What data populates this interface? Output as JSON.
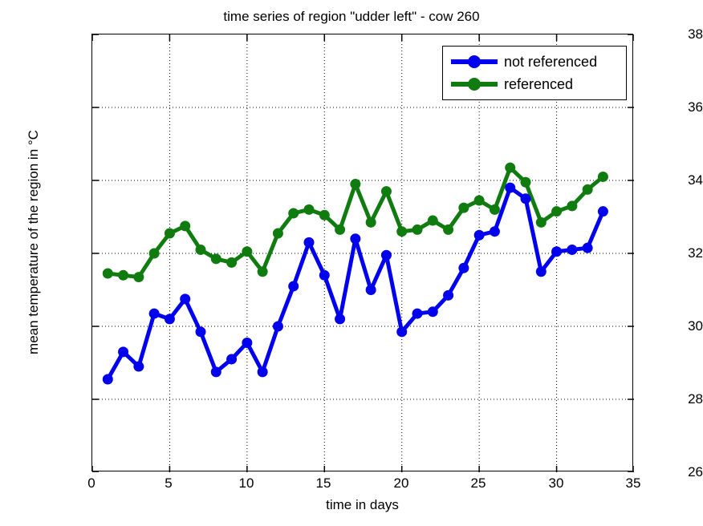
{
  "chart_data": {
    "type": "line",
    "title": "time series of region \"udder left\" - cow 260",
    "xlabel": "time in days",
    "ylabel": "mean temperature of the region in °C",
    "xlim": [
      0,
      35
    ],
    "ylim": [
      26,
      38
    ],
    "xticks": [
      0,
      5,
      10,
      15,
      20,
      25,
      30,
      35
    ],
    "yticks": [
      26,
      28,
      30,
      32,
      34,
      36,
      38
    ],
    "grid": true,
    "legend_position": "top-right",
    "x": [
      1,
      2,
      3,
      4,
      5,
      6,
      7,
      8,
      9,
      10,
      11,
      12,
      13,
      14,
      15,
      16,
      17,
      18,
      19,
      20,
      21,
      22,
      23,
      24,
      25,
      26,
      27,
      28,
      29,
      30,
      31,
      32,
      33
    ],
    "series": [
      {
        "name": "not referenced",
        "color": "#0000ee",
        "values": [
          28.55,
          29.3,
          28.9,
          30.35,
          30.2,
          30.75,
          29.85,
          28.75,
          29.1,
          29.55,
          28.75,
          30.0,
          31.1,
          32.3,
          31.4,
          30.2,
          32.4,
          31.0,
          31.95,
          29.85,
          30.35,
          30.4,
          30.85,
          31.6,
          32.5,
          32.6,
          33.8,
          33.5,
          31.5,
          32.05,
          32.1,
          32.15,
          33.15
        ]
      },
      {
        "name": "referenced",
        "color": "#107c10",
        "values": [
          31.45,
          31.4,
          31.35,
          32.0,
          32.55,
          32.75,
          32.1,
          31.85,
          31.75,
          32.05,
          31.5,
          32.55,
          33.1,
          33.2,
          33.05,
          32.65,
          33.9,
          32.85,
          33.7,
          32.6,
          32.65,
          32.9,
          32.65,
          33.25,
          33.45,
          33.2,
          34.35,
          33.95,
          32.85,
          33.15,
          33.3,
          33.75,
          34.1
        ]
      }
    ]
  },
  "legend": {
    "entries": [
      {
        "label": "not referenced"
      },
      {
        "label": "referenced"
      }
    ]
  },
  "axes": {
    "ytick_labels": [
      "38",
      "36",
      "34",
      "32",
      "30",
      "28",
      "26"
    ],
    "xtick_labels": [
      "0",
      "5",
      "10",
      "15",
      "20",
      "25",
      "30",
      "35"
    ]
  }
}
